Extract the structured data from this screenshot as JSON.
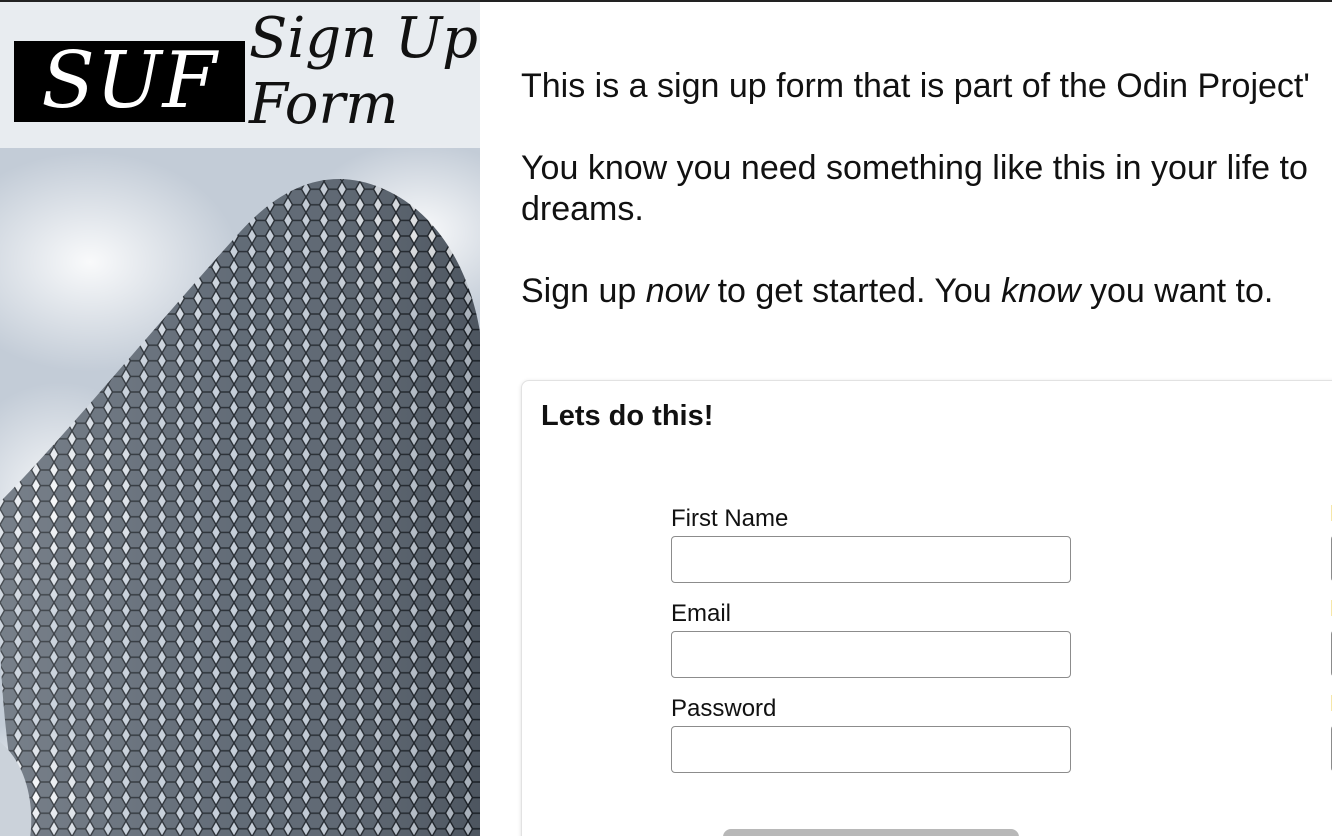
{
  "brand": {
    "logo_text": "SUF",
    "title_line1": "Sign Up",
    "title_line2": "Form"
  },
  "intro": {
    "line1": "This is a sign up form that is part of the Odin Project'",
    "line2": "You know you need something like this in your life to",
    "line2b": "dreams.",
    "line3_a": "Sign up ",
    "line3_now": "now",
    "line3_b": " to get started. You ",
    "line3_know": "know",
    "line3_c": " you want to."
  },
  "form": {
    "title": "Lets do this!",
    "first_name_label": "First Name",
    "email_label": "Email",
    "password_label": "Password",
    "first_name_value": "",
    "email_value": "",
    "password_value": ""
  },
  "colors": {
    "logo_bg": "#000000",
    "button_bg": "#b8b8b8",
    "ghost_label": "#f6e7a8"
  }
}
